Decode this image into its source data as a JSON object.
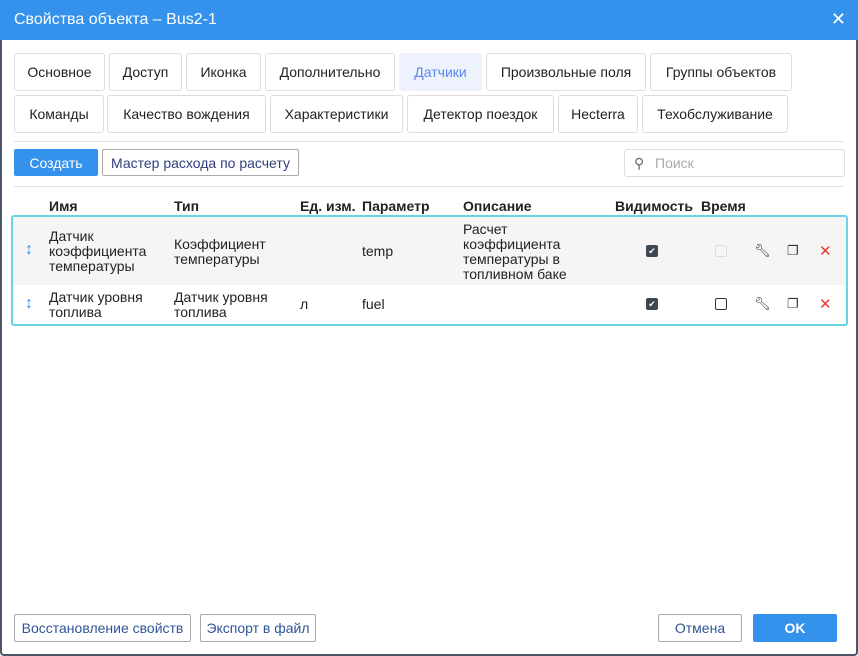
{
  "title": "Свойства объекта – Bus2-1",
  "tabs_row1": [
    "Основное",
    "Доступ",
    "Иконка",
    "Дополнительно",
    "Датчики",
    "Произвольные поля",
    "Группы объектов"
  ],
  "tabs_row2": [
    "Команды",
    "Качество вождения",
    "Характеристики",
    "Детектор поездок",
    "Hecterra",
    "Техобслуживание"
  ],
  "active_tab": "Датчики",
  "toolbar": {
    "create": "Создать",
    "wizard": "Мастер расхода по расчету",
    "search_placeholder": "Поиск"
  },
  "columns": [
    "Имя",
    "Тип",
    "Ед. изм.",
    "Параметр",
    "Описание",
    "Видимость",
    "Время"
  ],
  "rows": [
    {
      "name": "Датчик коэффициента температуры",
      "type": "Коэффициент температуры",
      "unit": "",
      "param": "temp",
      "desc": "Расчет коэффициента температуры в топливном баке",
      "visible": true,
      "time": false,
      "time_disabled": true
    },
    {
      "name": "Датчик уровня топлива",
      "type": "Датчик уровня топлива",
      "unit": "л",
      "param": "fuel",
      "desc": "",
      "visible": true,
      "time": false,
      "time_disabled": false
    }
  ],
  "footer": {
    "restore": "Восстановление свойств",
    "export": "Экспорт в файл",
    "cancel": "Отмена",
    "ok": "OK"
  },
  "colors": {
    "header": "#3592ec",
    "active_tab": "#5c86f0",
    "delete": "#e53935",
    "row_border": "#6ad3e6"
  }
}
